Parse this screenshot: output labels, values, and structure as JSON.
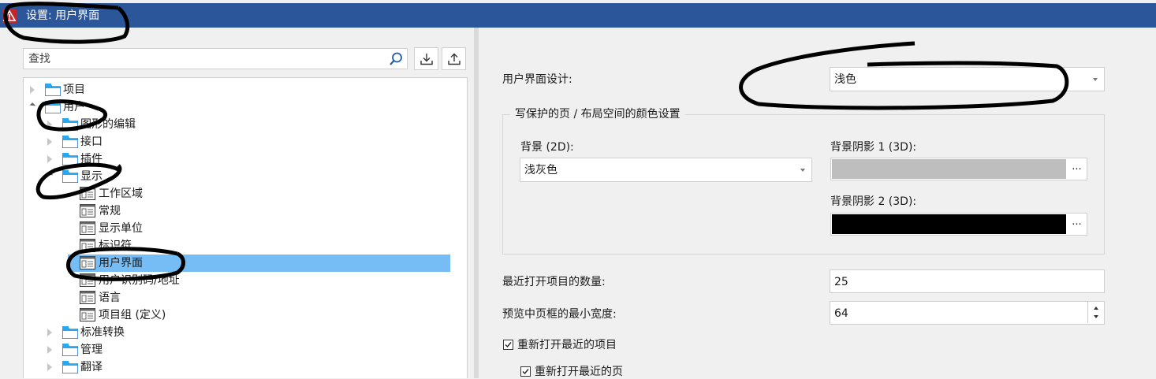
{
  "window": {
    "title": "设置: 用户界面",
    "icon": "warning-icon",
    "accent": "#2b579a"
  },
  "search": {
    "placeholder": "查找",
    "icon": "search-icon"
  },
  "toolbar": {
    "import_icon": "import-icon",
    "export_icon": "export-icon"
  },
  "tree": {
    "selection_color": "#77bdf5",
    "items": [
      {
        "label": "项目"
      },
      {
        "label": "用户"
      },
      {
        "label": "图形的编辑"
      },
      {
        "label": "接口"
      },
      {
        "label": "插件"
      },
      {
        "label": "显示"
      },
      {
        "label": "工作区域"
      },
      {
        "label": "常规"
      },
      {
        "label": "显示单位"
      },
      {
        "label": "标识符"
      },
      {
        "label": "用户界面",
        "selected": true
      },
      {
        "label": "用户识别码/地址"
      },
      {
        "label": "语言"
      },
      {
        "label": "项目组 (定义)"
      },
      {
        "label": "标准转换"
      },
      {
        "label": "管理"
      },
      {
        "label": "翻译"
      }
    ]
  },
  "settings": {
    "ui_design": {
      "label": "用户界面设计:",
      "value": "浅色"
    },
    "group_title": "写保护的页 / 布局空间的颜色设置",
    "background_2d": {
      "label": "背景 (2D):",
      "value": "浅灰色"
    },
    "shade1": {
      "label": "背景阴影 1 (3D):",
      "color": "#bebebe",
      "button": "..."
    },
    "shade2": {
      "label": "背景阴影 2 (3D):",
      "color": "#000000",
      "button": "..."
    },
    "recent_count": {
      "label": "最近打开项目的数量:",
      "value": "25"
    },
    "preview_width": {
      "label": "预览中页框的最小宽度:",
      "value": "64"
    },
    "reopen_projects": {
      "label": "重新打开最近的项目",
      "checked": true
    },
    "reopen_pages": {
      "label": "重新打开最近的页",
      "checked": true
    }
  }
}
